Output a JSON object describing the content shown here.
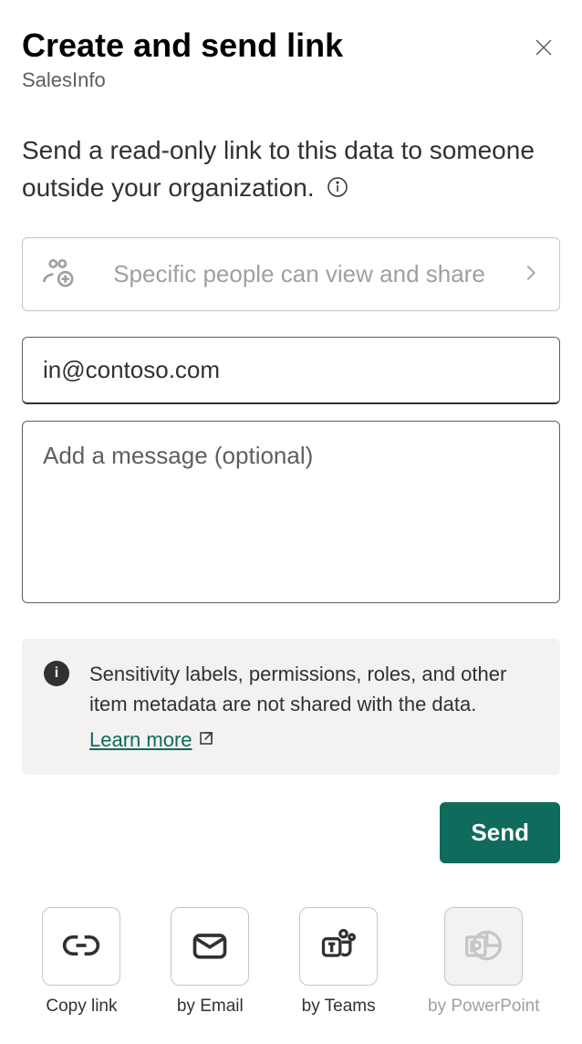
{
  "header": {
    "title": "Create and send link",
    "subtitle": "SalesInfo"
  },
  "description": "Send a read-only link to this data to someone outside your organization.",
  "permission": {
    "label": "Specific people can view and share"
  },
  "email": {
    "value": "in@contoso.com"
  },
  "message": {
    "placeholder": "Add a message (optional)",
    "value": ""
  },
  "infoBanner": {
    "text": "Sensitivity labels, permissions, roles, and other item metadata are not shared with the data.",
    "learnMore": "Learn more"
  },
  "sendButton": "Send",
  "actions": {
    "copyLink": "Copy link",
    "byEmail": "by Email",
    "byTeams": "by Teams",
    "byPowerPoint": "by PowerPoint"
  }
}
